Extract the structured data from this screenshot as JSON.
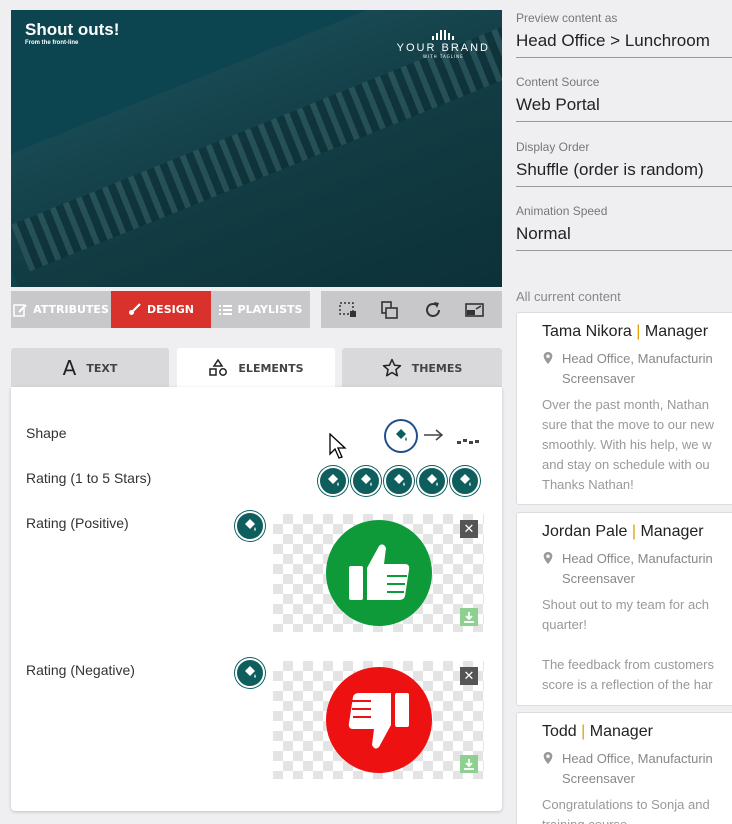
{
  "preview": {
    "title": "Shout outs!",
    "subtitle": "From the front-line",
    "brand_name": "YOUR BRAND",
    "brand_tagline": "WITH TAGLINE"
  },
  "mode_tabs": [
    {
      "label": "ATTRIBUTES",
      "icon": "edit-icon",
      "active": false
    },
    {
      "label": "DESIGN",
      "icon": "brush-icon",
      "active": true
    },
    {
      "label": "PLAYLISTS",
      "icon": "list-icon",
      "active": false
    }
  ],
  "tools": [
    "crop-region-icon",
    "layers-icon",
    "refresh-icon",
    "cast-screen-icon"
  ],
  "design_tabs": [
    {
      "label": "TEXT",
      "icon": "text-icon"
    },
    {
      "label": "ELEMENTS",
      "icon": "shapes-icon",
      "active": true
    },
    {
      "label": "THEMES",
      "icon": "star-icon"
    }
  ],
  "elements": {
    "shape_label": "Shape",
    "rating_stars_label": "Rating (1 to 5 Stars)",
    "rating_positive_label": "Rating (Positive)",
    "rating_negative_label": "Rating (Negative)"
  },
  "colors": {
    "accent_red": "#d9312b",
    "paint_teal": "#0f5e5e",
    "positive_green": "#0f9a3a",
    "negative_red": "#ee1111"
  },
  "settings": {
    "preview_label": "Preview content as",
    "preview_value": "Head Office > Lunchroom",
    "source_label": "Content Source",
    "source_value": "Web Portal",
    "order_label": "Display Order",
    "order_value": "Shuffle (order is random)",
    "speed_label": "Animation Speed",
    "speed_value": "Normal"
  },
  "content_list": {
    "heading": "All current content",
    "items": [
      {
        "name": "Tama Nikora",
        "role": "Manager",
        "location": "Head Office, Manufacturin\nScreensaver",
        "body": "Over the past month, Nathan\nsure that the move to our new\nsmoothly. With his help, we w\nand stay on schedule with ou\nThanks Nathan!"
      },
      {
        "name": "Jordan Pale",
        "role": "Manager",
        "location": "Head Office, Manufacturin\nScreensaver",
        "body": "Shout out to my team for ach\nquarter!\n\nThe feedback from customers\nscore is a reflection of the har"
      },
      {
        "name": "Todd",
        "role": "Manager",
        "location": "Head Office, Manufacturin\nScreensaver",
        "body": "Congratulations to Sonja and\ntraining course"
      }
    ]
  }
}
